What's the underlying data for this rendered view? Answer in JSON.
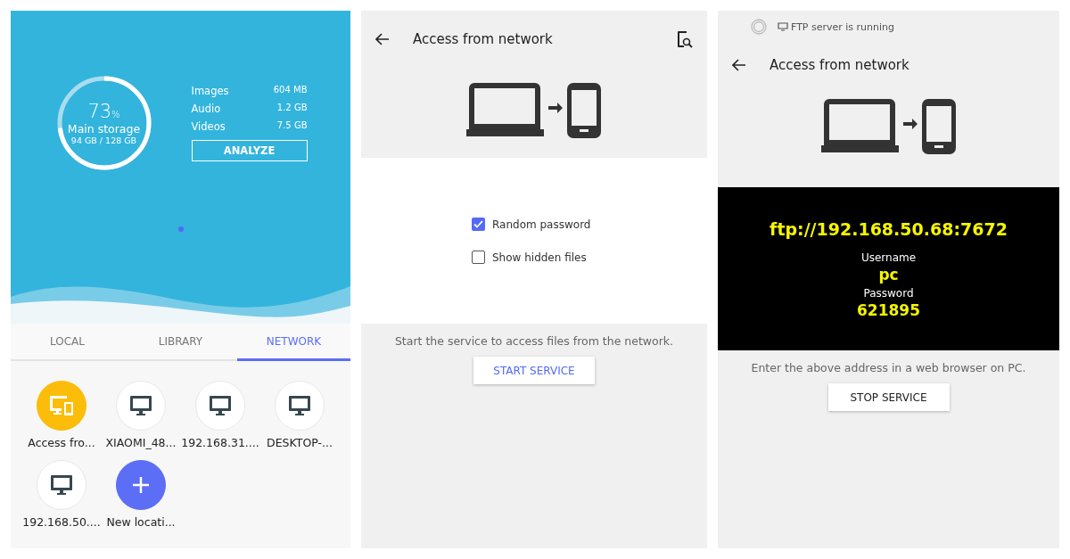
{
  "storage_panel": {
    "percent": "73",
    "percent_sign": "%",
    "title": "Main storage",
    "usage": "94 GB / 128 GB",
    "level": 0.73,
    "categories": [
      {
        "name": "Images",
        "size": "604 MB"
      },
      {
        "name": "Audio",
        "size": "1.2 GB"
      },
      {
        "name": "Videos",
        "size": "7.5 GB"
      }
    ],
    "analyze_button": "ANALYZE"
  },
  "tabs": [
    {
      "label": "LOCAL",
      "selected": false
    },
    {
      "label": "LIBRARY",
      "selected": false
    },
    {
      "label": "NETWORK",
      "selected": true
    }
  ],
  "locations": [
    {
      "label": "Access fro...",
      "kind": "access"
    },
    {
      "label": "XIAOMI_48...",
      "kind": "computer"
    },
    {
      "label": "192.168.31....",
      "kind": "computer"
    },
    {
      "label": "DESKTOP-...",
      "kind": "computer"
    },
    {
      "label": "192.168.50....",
      "kind": "computer"
    },
    {
      "label": "New locati...",
      "kind": "add"
    }
  ],
  "setup_screen": {
    "title": "Access from network",
    "options": [
      {
        "label": "Random password",
        "checked": true
      },
      {
        "label": "Show hidden files",
        "checked": false
      }
    ],
    "message": "Start the service to access files from the network.",
    "button": "START SERVICE"
  },
  "running_screen": {
    "notification": "FTP server is running",
    "title": "Access from network",
    "address": "ftp://192.168.50.68:7672",
    "username_label": "Username",
    "username": "pc",
    "password_label": "Password",
    "password": "621895",
    "message": "Enter the above address in a web browser on PC.",
    "button": "STOP SERVICE"
  }
}
